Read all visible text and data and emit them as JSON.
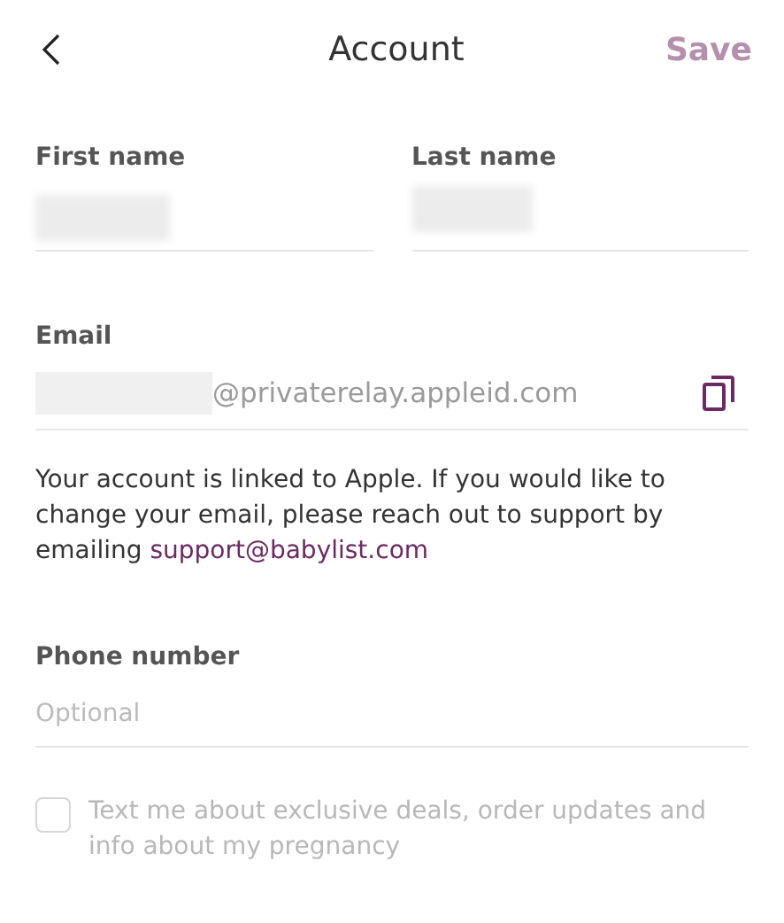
{
  "header": {
    "title": "Account",
    "save": {
      "label": "Save",
      "disabled": true
    }
  },
  "name_fields": [
    {
      "label": "First name",
      "redacted": true
    },
    {
      "label": "Last name",
      "redacted": true
    }
  ],
  "email": {
    "label": "Email",
    "redacted": true,
    "value": "@privaterelay.appleid.com"
  },
  "notice": {
    "text": "Your account is linked to Apple. If you would like to change your email, please reach out to support by emailing",
    "link": "support@babylist.com"
  },
  "phone": {
    "label": "Phone number",
    "placeholder": "Optional"
  },
  "sms_opt_in": {
    "label": "Text me about exclusive deals, order updates and info about my pregnancy",
    "checked": false,
    "disabled": true
  }
}
